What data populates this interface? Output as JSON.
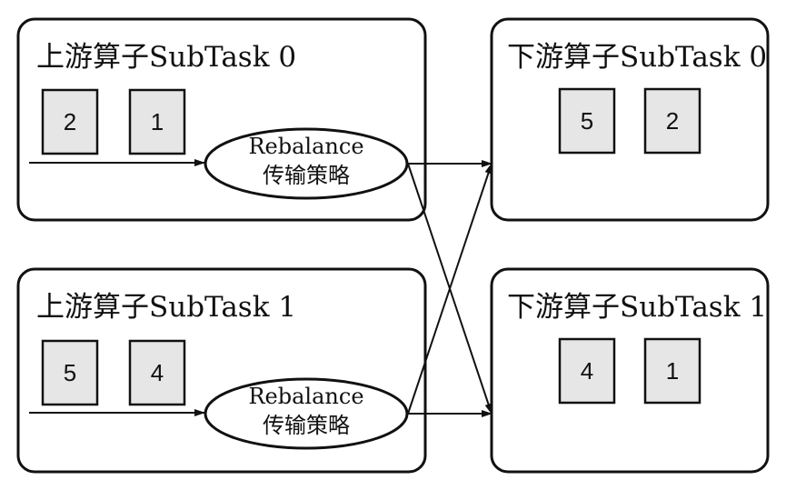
{
  "upstream": [
    {
      "title": "上游算子SubTask 0",
      "records": [
        "2",
        "1"
      ],
      "strategy": [
        "Rebalance",
        "传输策略"
      ]
    },
    {
      "title": "上游算子SubTask 1",
      "records": [
        "5",
        "4"
      ],
      "strategy": [
        "Rebalance",
        "传输策略"
      ]
    }
  ],
  "downstream": [
    {
      "title": "下游算子SubTask 0",
      "records": [
        "5",
        "2"
      ]
    },
    {
      "title": "下游算子SubTask 1",
      "records": [
        "4",
        "1"
      ]
    }
  ],
  "colors": {
    "box_fill": "#ffffff",
    "record_fill": "#e6e6e6",
    "stroke": "#111111"
  }
}
